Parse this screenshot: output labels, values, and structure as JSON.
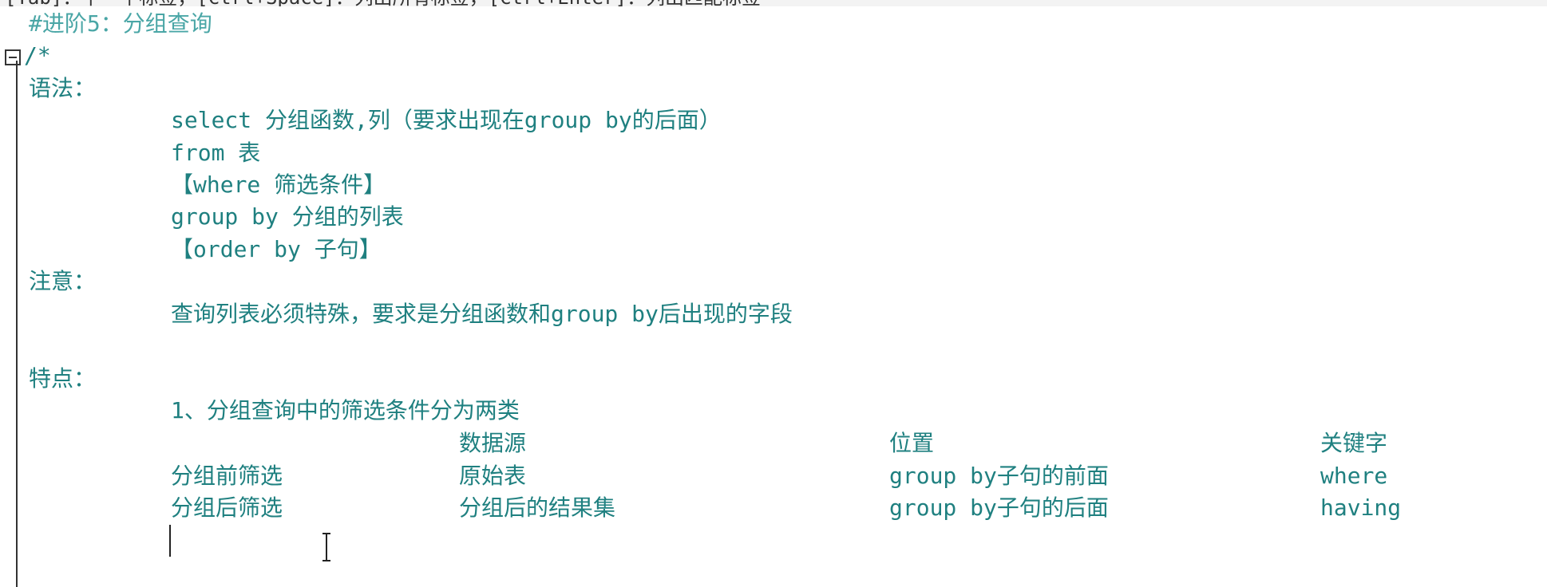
{
  "hint_bar": "[Tab]：下一个标签，[Ctrl+Space]：列出所有标签，[Ctrl+Enter]：列出匹配标签",
  "lines": {
    "title": "#进阶5：分组查询",
    "comment_open": "/*",
    "syntax_label": "语法：",
    "syntax": [
      "select 分组函数,列（要求出现在group by的后面）",
      "from 表",
      "【where 筛选条件】",
      "group by 分组的列表",
      "【order by 子句】"
    ],
    "note_label": "注意：",
    "note": "查询列表必须特殊，要求是分组函数和group by后出现的字段",
    "features_label": "特点：",
    "feature_1": "1、分组查询中的筛选条件分为两类"
  },
  "table": {
    "headers": [
      "",
      "数据源",
      "位置",
      "关键字"
    ],
    "rows": [
      [
        "分组前筛选",
        "原始表",
        "group by子句的前面",
        "where"
      ],
      [
        "分组后筛选",
        "分组后的结果集",
        "group by子句的后面",
        "having"
      ]
    ]
  }
}
